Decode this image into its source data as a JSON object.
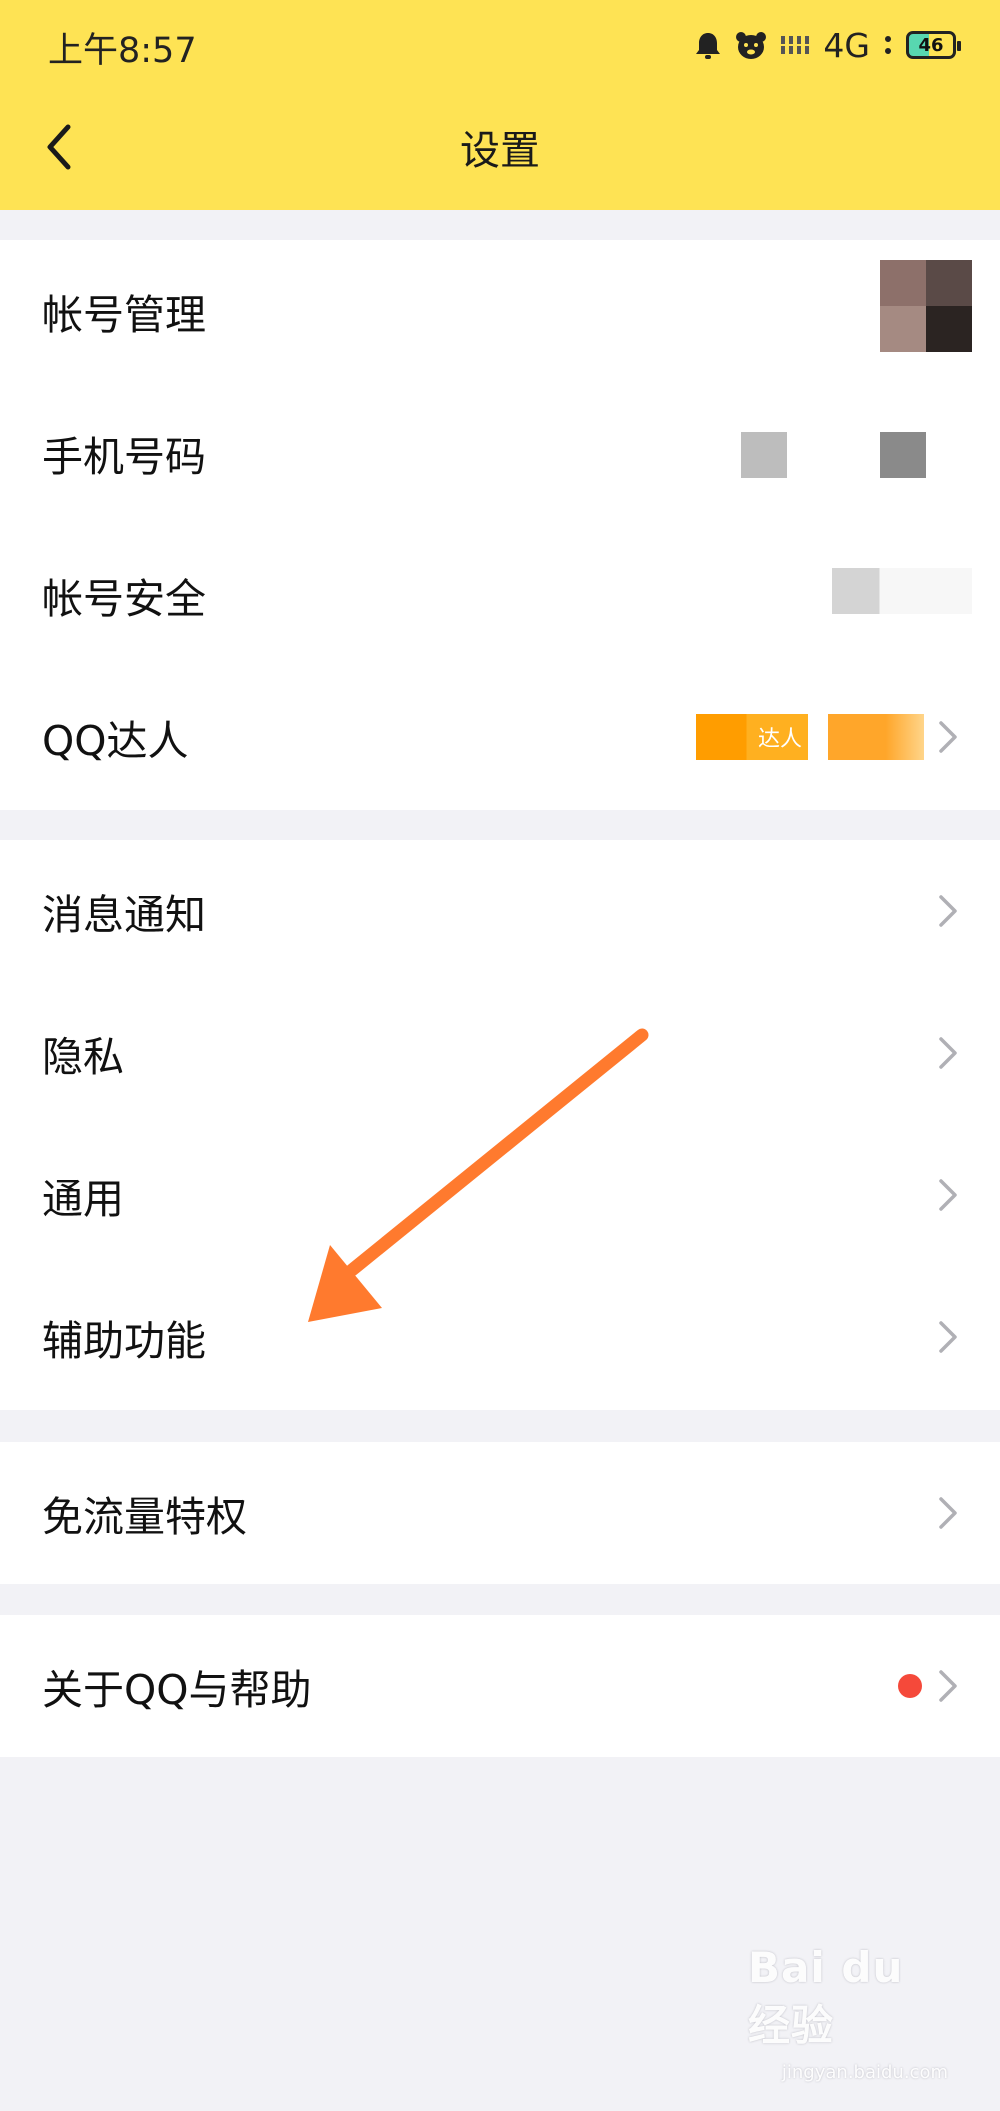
{
  "status_bar": {
    "time": "上午8:57",
    "network": "4G",
    "battery": "46",
    "icons": [
      "alarm-icon",
      "bear-icon",
      "signal-icon"
    ]
  },
  "header": {
    "title": "设置",
    "back_icon": "chevron-left-icon",
    "background": "#fee354"
  },
  "groups": [
    {
      "rows": [
        {
          "label": "帐号管理"
        },
        {
          "label": "手机号码"
        },
        {
          "label": "帐号安全"
        },
        {
          "label": "QQ达人",
          "badge_text": "达人"
        }
      ]
    },
    {
      "rows": [
        {
          "label": "消息通知"
        },
        {
          "label": "隐私"
        },
        {
          "label": "通用"
        },
        {
          "label": "辅助功能"
        }
      ]
    },
    {
      "rows": [
        {
          "label": "免流量特权"
        }
      ]
    },
    {
      "rows": [
        {
          "label": "关于QQ与帮助"
        }
      ]
    }
  ],
  "annotation": {
    "arrow_color": "#ff7a2e"
  },
  "watermark": {
    "main": "Bai du 经验",
    "sub": "jingyan.baidu.com"
  }
}
